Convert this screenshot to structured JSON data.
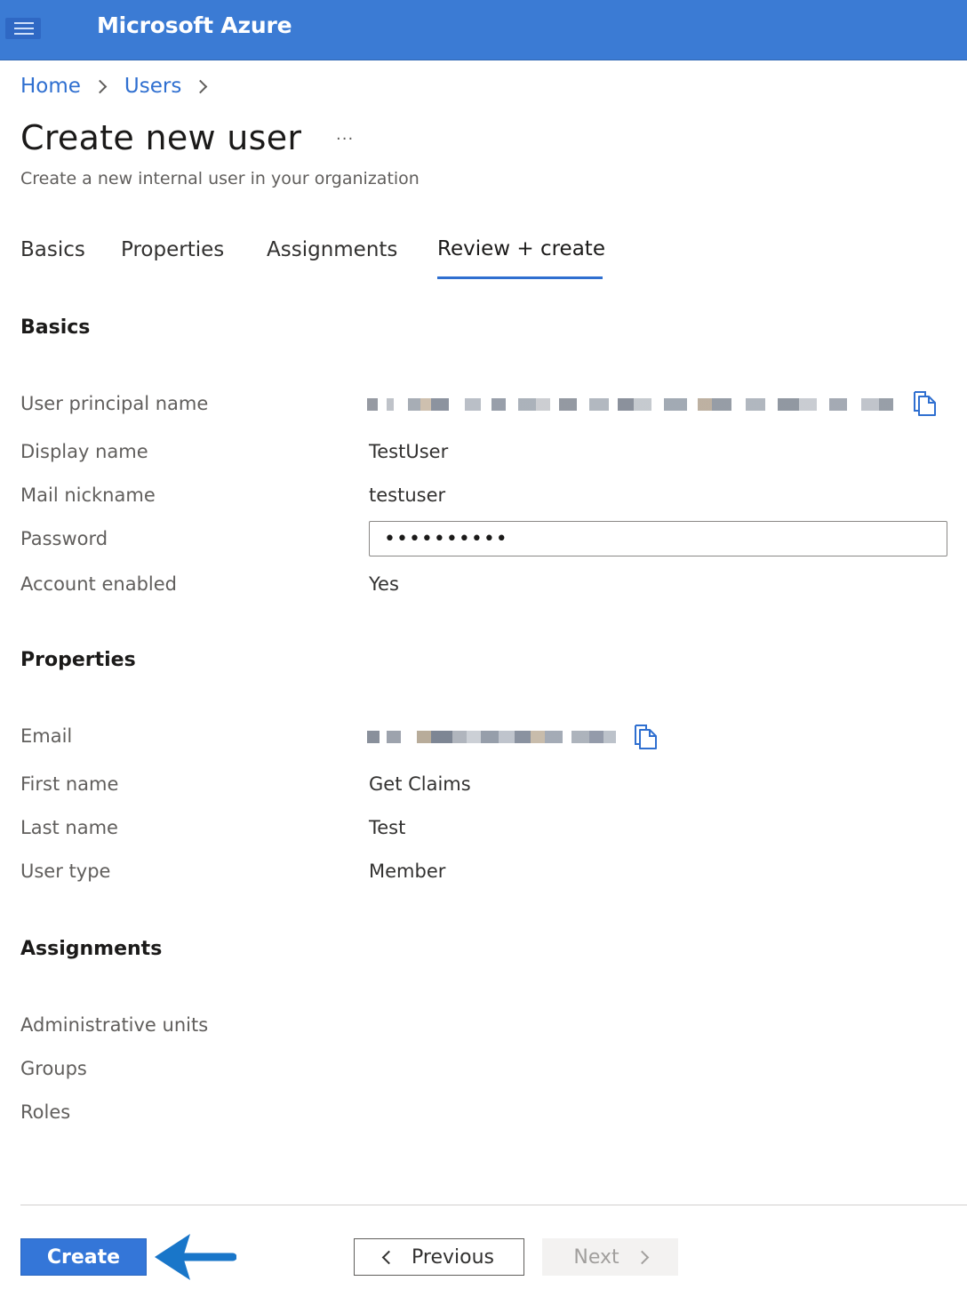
{
  "app": {
    "title": "Microsoft Azure"
  },
  "breadcrumb": {
    "items": [
      "Home",
      "Users"
    ]
  },
  "page": {
    "title": "Create new user",
    "more": "···",
    "subtitle": "Create a new internal user in your organization"
  },
  "tabs": {
    "items": [
      "Basics",
      "Properties",
      "Assignments",
      "Review + create"
    ],
    "active": "Review + create"
  },
  "basics": {
    "heading": "Basics",
    "user_principal_name_label": "User principal name",
    "display_name_label": "Display name",
    "display_name_value": "TestUser",
    "mail_nickname_label": "Mail nickname",
    "mail_nickname_value": "testuser",
    "password_label": "Password",
    "password_value": "••••••••••",
    "account_enabled_label": "Account enabled",
    "account_enabled_value": "Yes"
  },
  "properties": {
    "heading": "Properties",
    "email_label": "Email",
    "first_name_label": "First name",
    "first_name_value": "Get Claims",
    "last_name_label": "Last name",
    "last_name_value": "Test",
    "user_type_label": "User type",
    "user_type_value": "Member"
  },
  "assignments": {
    "heading": "Assignments",
    "administrative_units_label": "Administrative units",
    "groups_label": "Groups",
    "roles_label": "Roles"
  },
  "footer": {
    "create_label": "Create",
    "previous_label": "Previous",
    "next_label": "Next"
  },
  "icons": {
    "menu": "hamburger-menu-icon",
    "copy": "copy-icon",
    "annotation": "arrow-left-icon"
  },
  "colors": {
    "header_bg": "#3b7bd4",
    "link": "#2f6fd0",
    "primary_button": "#3476d8",
    "annotation_arrow": "#1976c9"
  }
}
